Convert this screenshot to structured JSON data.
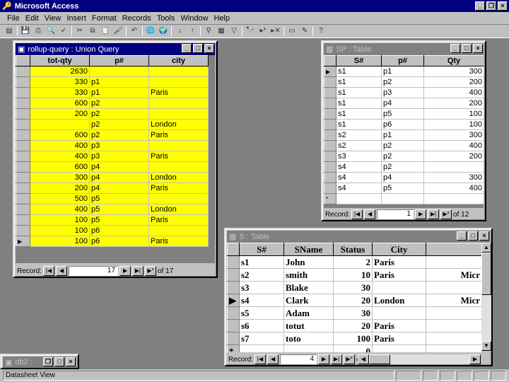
{
  "app": {
    "title": "Microsoft Access"
  },
  "menu": [
    "File",
    "Edit",
    "View",
    "Insert",
    "Format",
    "Records",
    "Tools",
    "Window",
    "Help"
  ],
  "toolbar_icons": [
    "view-icon",
    "save-icon",
    "print-icon",
    "print-preview-icon",
    "spelling-icon",
    "cut-icon",
    "copy-icon",
    "paste-icon",
    "format-painter-icon",
    "undo-icon",
    "insert-hyperlink-icon",
    "web-toolbar-icon",
    "sort-ascending-icon",
    "sort-descending-icon",
    "filter-by-selection-icon",
    "filter-by-form-icon",
    "apply-filter-icon",
    "find-icon",
    "new-record-icon",
    "delete-record-icon",
    "database-window-icon",
    "new-object-icon",
    "office-assistant-icon"
  ],
  "query_window": {
    "title": "rollup-query : Union Query",
    "columns": [
      "tot-qty",
      "p#",
      "city"
    ],
    "rows": [
      [
        "2630",
        "",
        ""
      ],
      [
        "330",
        "p1",
        ""
      ],
      [
        "330",
        "p1",
        "Paris"
      ],
      [
        "600",
        "p2",
        ""
      ],
      [
        "200",
        "p2",
        ""
      ],
      [
        "",
        "p2",
        "London"
      ],
      [
        "600",
        "p2",
        "Paris"
      ],
      [
        "400",
        "p3",
        ""
      ],
      [
        "400",
        "p3",
        "Paris"
      ],
      [
        "600",
        "p4",
        ""
      ],
      [
        "300",
        "p4",
        "London"
      ],
      [
        "200",
        "p4",
        "Paris"
      ],
      [
        "500",
        "p5",
        ""
      ],
      [
        "400",
        "p5",
        "London"
      ],
      [
        "100",
        "p5",
        "Paris"
      ],
      [
        "100",
        "p6",
        ""
      ],
      [
        "100",
        "p6",
        "Paris"
      ]
    ],
    "current_row": 16,
    "record_label": "Record:",
    "record_value": "17",
    "record_of": "of 17",
    "row_color": "#ffff00"
  },
  "sp_window": {
    "title": "SP : Table",
    "columns": [
      "S#",
      "p#",
      "Qty"
    ],
    "rows": [
      [
        "s1",
        "p1",
        "300"
      ],
      [
        "s1",
        "p2",
        "200"
      ],
      [
        "s1",
        "p3",
        "400"
      ],
      [
        "s1",
        "p4",
        "200"
      ],
      [
        "s1",
        "p5",
        "100"
      ],
      [
        "s1",
        "p6",
        "100"
      ],
      [
        "s2",
        "p1",
        "300"
      ],
      [
        "s2",
        "p2",
        "400"
      ],
      [
        "s3",
        "p2",
        "200"
      ],
      [
        "s4",
        "p2",
        ""
      ],
      [
        "s4",
        "p4",
        "300"
      ],
      [
        "s4",
        "p5",
        "400"
      ]
    ],
    "current_row": 0,
    "record_label": "Record:",
    "record_value": "1",
    "record_of": "of 12"
  },
  "s_window": {
    "title": "S : Table",
    "columns": [
      "S#",
      "SName",
      "Status",
      "City",
      ""
    ],
    "rows": [
      [
        "s1",
        "John",
        "2",
        "Paris",
        ""
      ],
      [
        "s2",
        "smith",
        "10",
        "Paris",
        "Micr"
      ],
      [
        "s3",
        "Blake",
        "30",
        "",
        ""
      ],
      [
        "s4",
        "Clark",
        "20",
        "London",
        "Micr"
      ],
      [
        "s5",
        "Adam",
        "30",
        "",
        ""
      ],
      [
        "s6",
        "totut",
        "20",
        "Paris",
        ""
      ],
      [
        "s7",
        "toto",
        "100",
        "Paris",
        ""
      ]
    ],
    "new_row": [
      "",
      "",
      "0",
      "",
      ""
    ],
    "current_row": 3,
    "record_label": "Record:",
    "record_value": "4",
    "record_of": "of 7"
  },
  "minimized_window": {
    "title": "db2 :"
  },
  "status_bar": {
    "text": "Datasheet View"
  }
}
